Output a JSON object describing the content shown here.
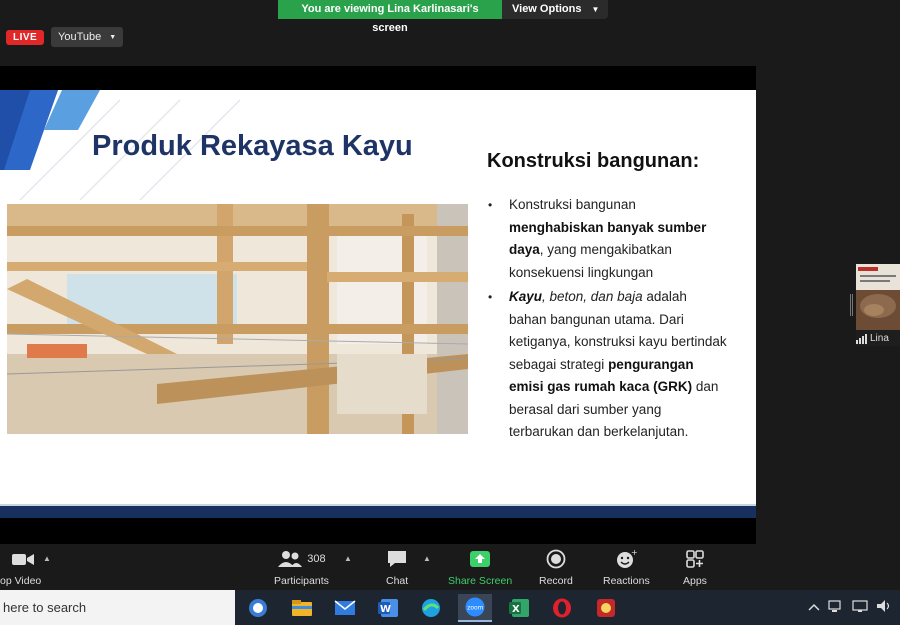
{
  "banner": {
    "message": "You are viewing Lina Karlinasari's screen",
    "view_options": "View Options"
  },
  "stream": {
    "live_label": "LIVE",
    "platform": "YouTube"
  },
  "slide": {
    "title": "Produk Rekayasa Kayu",
    "right_heading": "Konstruksi bangunan:",
    "bullet1": {
      "t1": "Konstruksi bangunan ",
      "b1": "menghabiskan banyak sumber daya",
      "t2": ", yang mengakibatkan konsekuensi lingkungan"
    },
    "bullet2": {
      "b1": "Kayu",
      "i1": ", beton, dan baja",
      "t1": " adalah bahan bangunan utama. Dari ketiganya, konstruksi kayu bertindak sebagai strategi ",
      "b2": "pengurangan emisi gas rumah kaca (GRK)",
      "t2": " dan berasal dari sumber yang terbarukan dan berkelanjutan."
    }
  },
  "participant": {
    "name": "Lina"
  },
  "toolbar": {
    "video_label": "op Video",
    "participants_label": "Participants",
    "participants_count": "308",
    "chat_label": "Chat",
    "share_label": "Share Screen",
    "record_label": "Record",
    "reactions_label": "Reactions",
    "apps_label": "Apps"
  },
  "taskbar": {
    "search_text": "here to search"
  },
  "colors": {
    "banner_green": "#2aa14b",
    "slide_title": "#1f3466",
    "share_green": "#3ccf6b",
    "live_red": "#e02828"
  }
}
